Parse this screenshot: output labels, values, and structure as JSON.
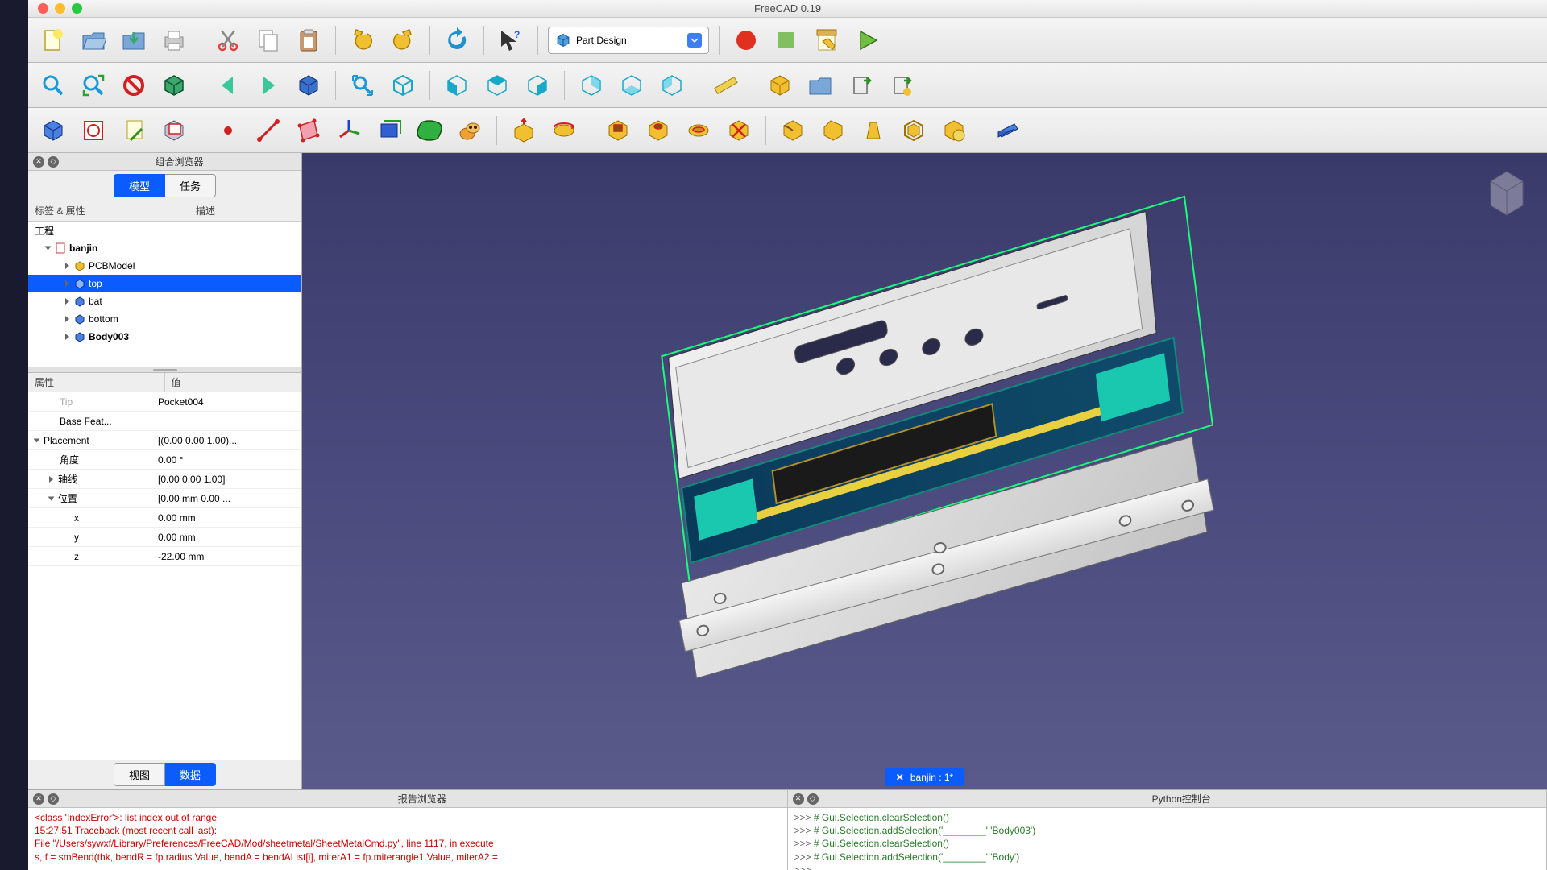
{
  "app": {
    "title": "FreeCAD 0.19"
  },
  "workbench": {
    "selected": "Part Design"
  },
  "combo_panel": {
    "title": "组合浏览器",
    "tabs": {
      "model": "模型",
      "task": "任务"
    },
    "headers": {
      "label": "标签 & 属性",
      "desc": "描述"
    },
    "root": "工程",
    "items": [
      {
        "name": "banjin",
        "depth": 0,
        "expanded": true,
        "bold": true,
        "icon": "doc"
      },
      {
        "name": "PCBModel",
        "depth": 1,
        "expanded": false,
        "icon": "part-yellow"
      },
      {
        "name": "top",
        "depth": 1,
        "expanded": false,
        "icon": "body",
        "selected": true
      },
      {
        "name": "bat",
        "depth": 1,
        "expanded": false,
        "icon": "body"
      },
      {
        "name": "bottom",
        "depth": 1,
        "expanded": false,
        "icon": "body"
      },
      {
        "name": "Body003",
        "depth": 1,
        "expanded": false,
        "icon": "body",
        "bold": true
      }
    ]
  },
  "properties": {
    "headers": {
      "prop": "属性",
      "val": "值"
    },
    "rows": [
      {
        "k": "Tip",
        "v": "Pocket004",
        "indent": 1,
        "faded": true
      },
      {
        "k": "Base Feat...",
        "v": "",
        "indent": 1
      },
      {
        "k": "Placement",
        "v": "[(0.00 0.00 1.00)...",
        "indent": 0,
        "expander": "open"
      },
      {
        "k": "角度",
        "v": "0.00 °",
        "indent": 1
      },
      {
        "k": "轴线",
        "v": "[0.00 0.00 1.00]",
        "indent": 1,
        "expander": "closed"
      },
      {
        "k": "位置",
        "v": "[0.00 mm  0.00 ...",
        "indent": 1,
        "expander": "open"
      },
      {
        "k": "x",
        "v": "0.00 mm",
        "indent": 2
      },
      {
        "k": "y",
        "v": "0.00 mm",
        "indent": 2
      },
      {
        "k": "z",
        "v": "-22.00 mm",
        "indent": 2
      }
    ],
    "tabs": {
      "view": "视图",
      "data": "数据"
    }
  },
  "viewport": {
    "active_doc": "banjin : 1*"
  },
  "report": {
    "title": "报告浏览器",
    "lines": [
      "<class 'IndexError'>: list index out of range",
      "15:27:51  Traceback (most recent call last):",
      "  File \"/Users/sywxf/Library/Preferences/FreeCAD/Mod/sheetmetal/SheetMetalCmd.py\", line 1117, in execute",
      "  s, f = smBend(thk, bendR = fp.radius.Value, bendA = bendAList[i], miterA1 = fp.miterangle1.Value, miterA2 ="
    ]
  },
  "python": {
    "title": "Python控制台",
    "lines": [
      ">>> # Gui.Selection.clearSelection()",
      ">>> # Gui.Selection.addSelection('________','Body003')",
      ">>> # Gui.Selection.clearSelection()",
      ">>> # Gui.Selection.addSelection('________','Body')",
      ">>> "
    ]
  },
  "icons": {
    "file": [
      "new",
      "open",
      "save",
      "print"
    ],
    "edit": [
      "cut",
      "copy",
      "paste"
    ],
    "undo": [
      "undo",
      "redo",
      "refresh",
      "whatsthis"
    ],
    "macro": [
      "record",
      "stop",
      "edit-macro",
      "run"
    ]
  }
}
